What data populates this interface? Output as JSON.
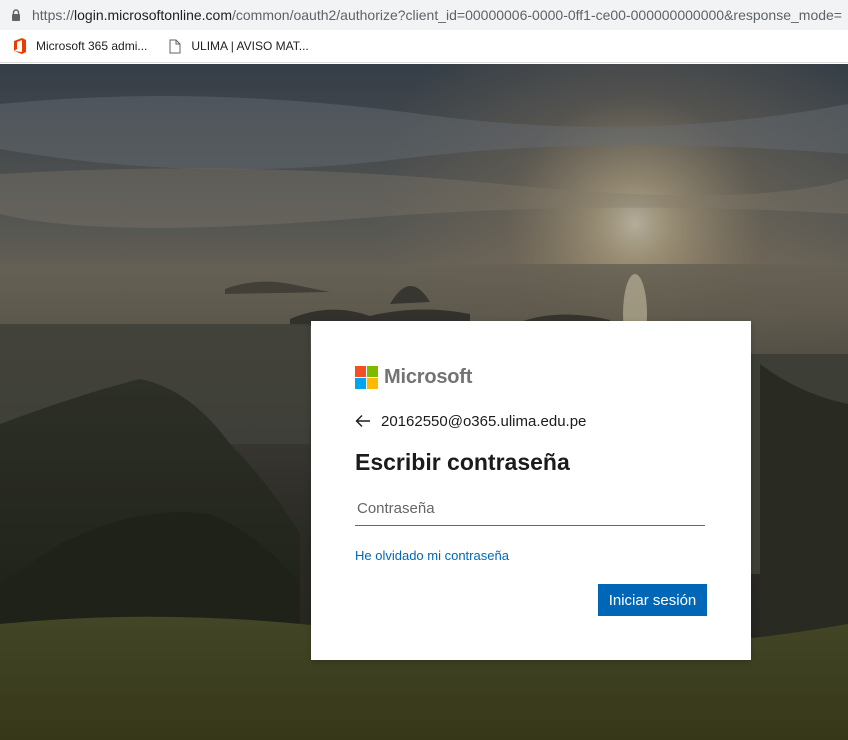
{
  "browser": {
    "url_prefix": "https://",
    "url_host": "login.microsoftonline.com",
    "url_rest": "/common/oauth2/authorize?client_id=00000006-0000-0ff1-ce00-000000000000&response_mode=",
    "bookmarks": [
      {
        "label": "Microsoft 365 admi...",
        "icon": "office-icon"
      },
      {
        "label": "ULIMA | AVISO MAT...",
        "icon": "page-icon"
      }
    ]
  },
  "login": {
    "brand": "Microsoft",
    "identity": "20162550@o365.ulima.edu.pe",
    "title": "Escribir contraseña",
    "password_placeholder": "Contraseña",
    "forgot_link": "He olvidado mi contraseña",
    "signin_label": "Iniciar sesión"
  },
  "colors": {
    "accent": "#0067b8",
    "logo_red": "#f25022",
    "logo_green": "#7fba00",
    "logo_blue": "#00a4ef",
    "logo_yellow": "#ffb900"
  }
}
